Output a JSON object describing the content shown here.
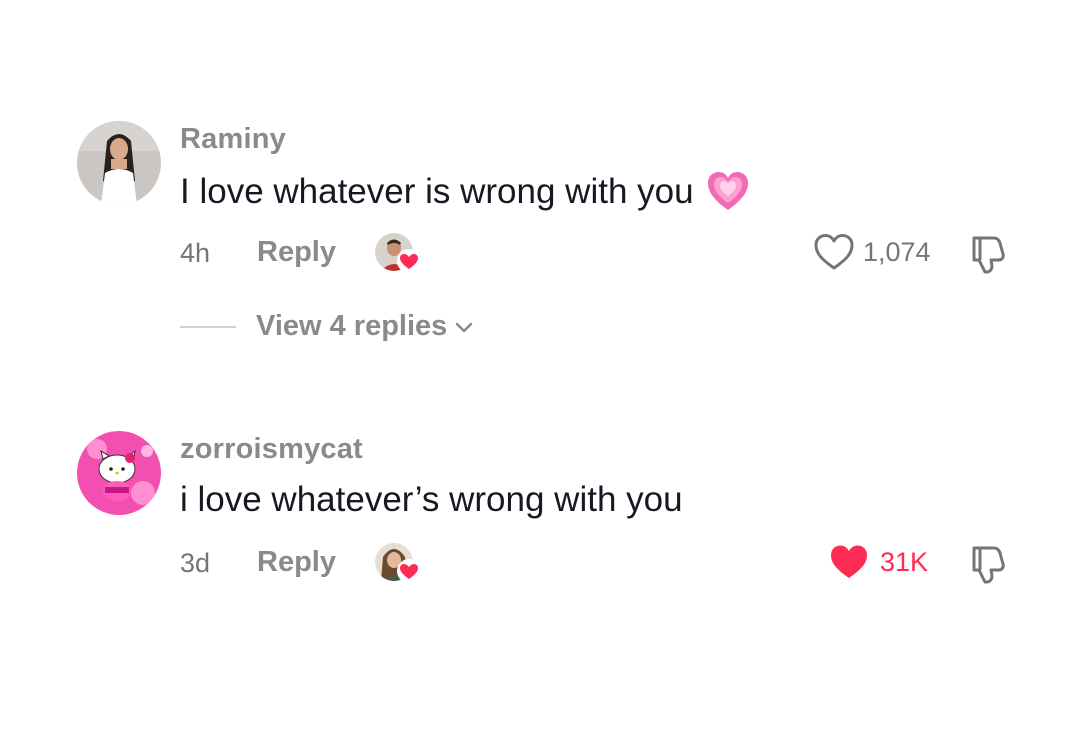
{
  "comments": [
    {
      "username": "Raminy",
      "text": "I love whatever is wrong with you",
      "emoji": "growing-heart-emoji",
      "time": "4h",
      "reply_label": "Reply",
      "like_count": "1,074",
      "liked": false,
      "view_replies_label": "View 4 replies"
    },
    {
      "username": "zorroismycat",
      "text": "i love whatever’s wrong with you",
      "time": "3d",
      "reply_label": "Reply",
      "like_count": "31K",
      "liked": true
    }
  ],
  "colors": {
    "username_gray": "#8a8a8a",
    "text_dark": "#161823",
    "liked_red": "#fe2c55",
    "meta_gray": "#757575"
  },
  "icons": {
    "like": "heart-outline-icon",
    "liked": "heart-filled-icon",
    "dislike": "thumbs-down-icon",
    "expand": "chevron-down-icon"
  }
}
